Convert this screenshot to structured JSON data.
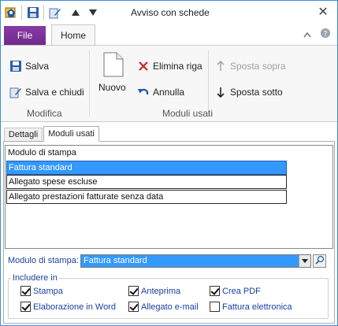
{
  "window": {
    "title": "Avviso con schede",
    "close": "✕"
  },
  "quick_access": [
    "app-icon",
    "save-icon",
    "edit-icon",
    "up-arrow-icon",
    "down-arrow-icon"
  ],
  "ribbon": {
    "tabs": {
      "file": "File",
      "home": "Home"
    },
    "modifica": {
      "label": "Modifica",
      "save": "Salva",
      "save_close": "Salva e chiudi"
    },
    "moduli_usati": {
      "label": "Moduli usati",
      "new": "Nuovo",
      "delete_row": "Elimina riga",
      "undo": "Annulla",
      "move_up": "Sposta sopra",
      "move_down": "Sposta sotto"
    }
  },
  "content_tabs": {
    "details": "Dettagli",
    "modules": "Moduli usati"
  },
  "modules_list": {
    "items": [
      {
        "label": "Modulo di stampa",
        "state": "header"
      },
      {
        "label": "Fattura standard",
        "state": "selected"
      },
      {
        "label": "Allegato spese escluse",
        "state": "boxed"
      },
      {
        "label": "Allegato prestazioni fatturate senza data",
        "state": "boxed"
      }
    ]
  },
  "print_module": {
    "label": "Modulo di stampa:",
    "value": "Fattura standard"
  },
  "include": {
    "title": "Includere in",
    "options": [
      {
        "label": "Stampa",
        "checked": true
      },
      {
        "label": "Anteprima",
        "checked": true
      },
      {
        "label": "Crea PDF",
        "checked": true
      },
      {
        "label": "Elaborazione in Word",
        "checked": true
      },
      {
        "label": "Allegato e-mail",
        "checked": true
      },
      {
        "label": "Fattura elettronica",
        "checked": false
      }
    ]
  },
  "colors": {
    "accent": "#3399ff",
    "file_tab": "#7b318f",
    "label_blue": "#1b3fa0",
    "border": "#3c8ed4"
  }
}
